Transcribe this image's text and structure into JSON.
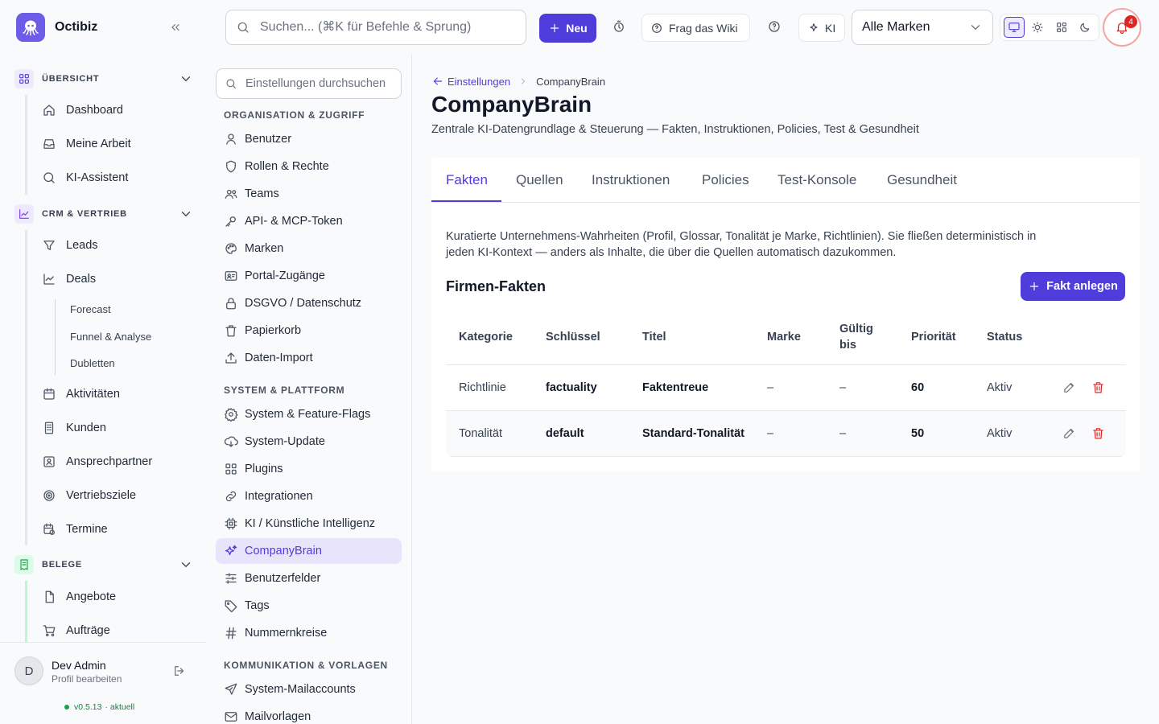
{
  "app": {
    "name": "Octibiz"
  },
  "sidebar": {
    "sections": [
      {
        "label": "ÜBERSICHT",
        "items": [
          "Dashboard",
          "Meine Arbeit",
          "KI-Assistent"
        ]
      },
      {
        "label": "CRM & VERTRIEB",
        "items": [
          "Leads",
          "Deals",
          "Aktivitäten",
          "Kunden",
          "Ansprechpartner",
          "Vertriebsziele",
          "Termine"
        ],
        "deals_sub": [
          "Forecast",
          "Funnel & Analyse",
          "Dubletten"
        ]
      },
      {
        "label": "BELEGE",
        "items": [
          "Angebote",
          "Aufträge"
        ]
      }
    ],
    "user": {
      "initial": "D",
      "name": "Dev Admin",
      "edit": "Profil bearbeiten",
      "version": "v0.5.13",
      "version_state": "· aktuell"
    }
  },
  "topbar": {
    "search_placeholder": "Suchen... (⌘K für Befehle & Sprung)",
    "new_label": "Neu",
    "wiki_label": "Frag das Wiki",
    "ki_label": "KI",
    "brand_select": "Alle Marken",
    "notifications": "4"
  },
  "settings": {
    "search_placeholder": "Einstellungen durchsuchen",
    "groups": [
      {
        "label": "ORGANISATION & ZUGRIFF",
        "items": [
          "Benutzer",
          "Rollen & Rechte",
          "Teams",
          "API- & MCP-Token",
          "Marken",
          "Portal-Zugänge",
          "DSGVO / Datenschutz",
          "Papierkorb",
          "Daten-Import"
        ]
      },
      {
        "label": "SYSTEM & PLATTFORM",
        "items": [
          "System & Feature-Flags",
          "System-Update",
          "Plugins",
          "Integrationen",
          "KI / Künstliche Intelligenz",
          "CompanyBrain",
          "Benutzerfelder",
          "Tags",
          "Nummernkreise"
        ]
      },
      {
        "label": "KOMMUNIKATION & VORLAGEN",
        "items": [
          "System-Mailaccounts",
          "Mailvorlagen"
        ]
      }
    ]
  },
  "main": {
    "breadcrumb": {
      "back": "Einstellungen",
      "current": "CompanyBrain"
    },
    "title": "CompanyBrain",
    "subtitle": "Zentrale KI-Datengrundlage & Steuerung — Fakten, Instruktionen, Policies, Test & Gesundheit",
    "tabs": [
      "Fakten",
      "Quellen",
      "Instruktionen",
      "Policies",
      "Test-Konsole",
      "Gesundheit"
    ],
    "description": "Kuratierte Unternehmens-Wahrheiten (Profil, Glossar, Tonalität je Marke, Richtlinien). Sie fließen deterministisch in jeden KI-Kontext — anders als Inhalte, die über die Quellen automatisch dazukommen.",
    "section_title": "Firmen-Fakten",
    "add_label": "Fakt anlegen",
    "table": {
      "headers": [
        "Kategorie",
        "Schlüssel",
        "Titel",
        "Marke",
        "Gültig bis",
        "Priorität",
        "Status"
      ],
      "header_valid_1": "Gültig",
      "header_valid_2": "bis",
      "rows": [
        {
          "kategorie": "Richtlinie",
          "schluessel": "factuality",
          "titel": "Faktentreue",
          "marke": "–",
          "gueltig": "–",
          "prioritaet": "60",
          "status": "Aktiv"
        },
        {
          "kategorie": "Tonalität",
          "schluessel": "default",
          "titel": "Standard-Tonalität",
          "marke": "–",
          "gueltig": "–",
          "prioritaet": "50",
          "status": "Aktiv"
        }
      ]
    }
  },
  "colors": {
    "accent": "#4f3ddb",
    "danger": "#dc2626"
  }
}
